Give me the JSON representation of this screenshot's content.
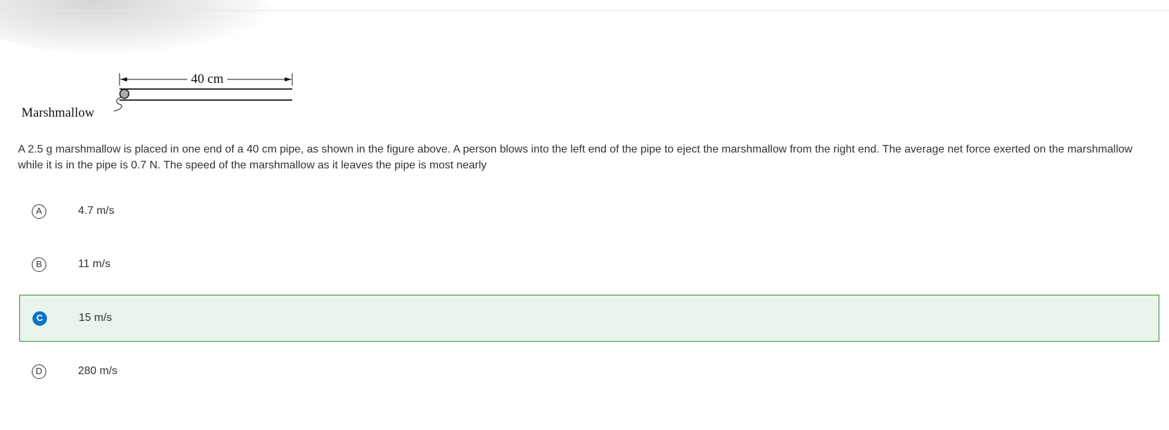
{
  "figure": {
    "dimension_label": "40 cm",
    "object_label": "Marshmallow"
  },
  "question": {
    "text": "A 2.5 g marshmallow is placed in one end of a 40 cm pipe, as shown in the figure above. A person blows into the left end of the pipe to eject the marshmallow from the right end. The average net force exerted on the marshmallow while it is in the pipe is 0.7 N. The speed of the marshmallow as it leaves the pipe is most nearly"
  },
  "choices": [
    {
      "letter": "A",
      "text": "4.7 m/s",
      "selected": false
    },
    {
      "letter": "B",
      "text": "11 m/s",
      "selected": false
    },
    {
      "letter": "C",
      "text": "15 m/s",
      "selected": true
    },
    {
      "letter": "D",
      "text": "280 m/s",
      "selected": false
    }
  ],
  "colors": {
    "selected_background": "#e9f4ea",
    "selected_border": "#2e8b3a",
    "selected_badge": "#0a73c9"
  }
}
